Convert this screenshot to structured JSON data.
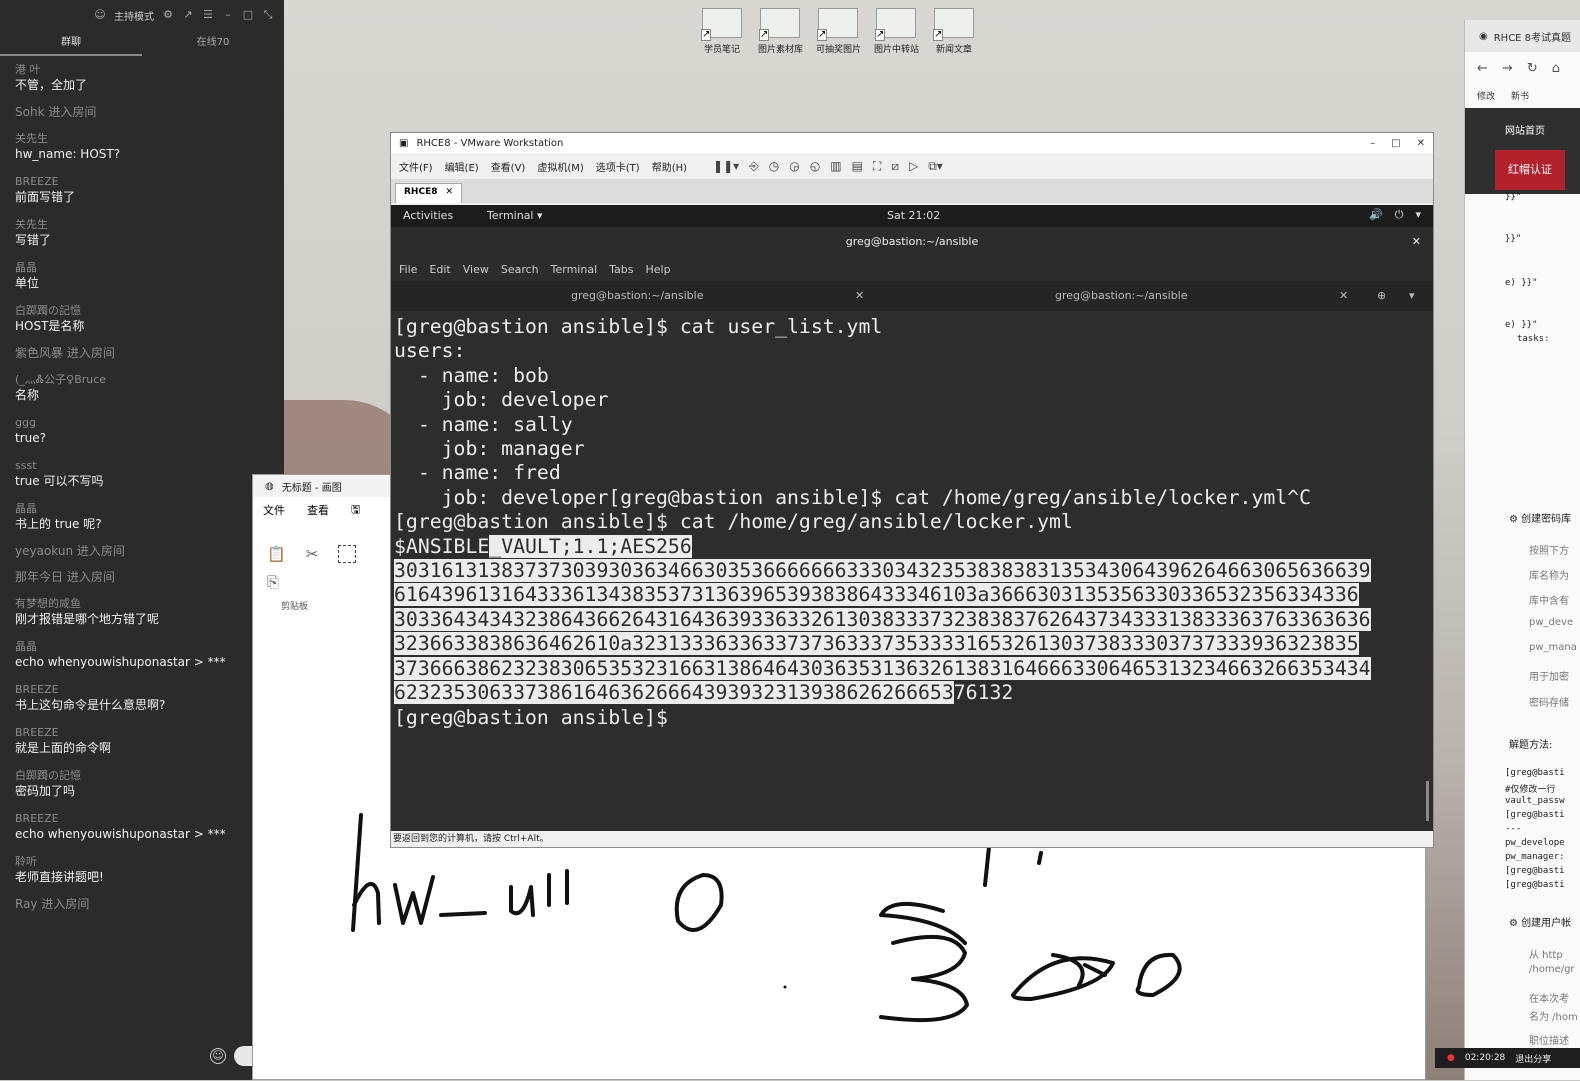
{
  "chat": {
    "top_label": "主持模式",
    "tabs": [
      "群聊",
      "在线70"
    ],
    "messages": [
      {
        "who": "港 叶",
        "text": "不管，全加了"
      },
      {
        "who": "Sohk 进入房间",
        "text": ""
      },
      {
        "who": "关先生",
        "text": "hw_name: HOST?"
      },
      {
        "who": "BREEZE",
        "text": "前面写错了"
      },
      {
        "who": "关先生",
        "text": "写错了"
      },
      {
        "who": "晶晶",
        "text": "单位"
      },
      {
        "who": "白踯躅の記憶",
        "text": "HOST是名称"
      },
      {
        "who": "紫色风暴 进入房间",
        "text": ""
      },
      {
        "who": "(_灬Ꮬ公子♀Bruce",
        "text": "名称"
      },
      {
        "who": "ggg",
        "text": "true?"
      },
      {
        "who": "ssst",
        "text": "true 可以不写吗"
      },
      {
        "who": "晶晶",
        "text": "书上的 true 呢?"
      },
      {
        "who": "yeyaokun 进入房间",
        "text": ""
      },
      {
        "who": "那年今日 进入房间",
        "text": ""
      },
      {
        "who": "有梦想的咸鱼",
        "text": "刚才报错是哪个地方错了呢"
      },
      {
        "who": "晶晶",
        "text": "echo whenyouwishuponastar > ***"
      },
      {
        "who": "BREEZE",
        "text": "书上这句命令是什么意思啊?"
      },
      {
        "who": "BREEZE",
        "text": "就是上面的命令啊"
      },
      {
        "who": "白踯躅の記憶",
        "text": "密码加了吗"
      },
      {
        "who": "BREEZE",
        "text": "echo whenyouwishuponastar > ***"
      },
      {
        "who": "聆听",
        "text": "老师直接讲题吧!"
      },
      {
        "who": "Ray 进入房间",
        "text": ""
      }
    ]
  },
  "desktop_icons": [
    "学员笔记",
    "图片素材库",
    "可抽奖图片",
    "图片中转站",
    "新闻文章"
  ],
  "paint": {
    "title": "无标题 - 画图",
    "menu": [
      "文件",
      "查看"
    ],
    "clipboard_label": "剪贴板",
    "handwriting": [
      "hw_u",
      "0",
      "5'",
      "300"
    ]
  },
  "browser": {
    "tab_title": "RHCE 8考试真题",
    "bookmarks": [
      "修改",
      "新书"
    ],
    "home": "网站首页",
    "redhat": "红帽认证",
    "code_lines": [
      "}}\"",
      "}}\"",
      "e) }}\"",
      "e) }}\"",
      "tasks:"
    ],
    "section1": "创建密码库",
    "items1": [
      "按照下方",
      "库名称为",
      "库中含有",
      "pw_deve",
      "pw_mana",
      "用于加密",
      "密码存储"
    ],
    "solve": "解题方法:",
    "code2": [
      "[greg@basti",
      "#仅修改一行",
      "vault_passw",
      "[greg@basti",
      "---",
      "pw_develope",
      "pw_manager:",
      "[greg@basti",
      "[greg@basti"
    ],
    "section2": "创建用户帐",
    "items2": [
      "从 http",
      "/home/gr",
      "在本次考",
      "名为 /hom",
      "职位描述"
    ],
    "timer": "02:20:28",
    "share": "退出分享"
  },
  "vmware": {
    "title": "RHCE8 - VMware Workstation",
    "menu": [
      "文件(F)",
      "编辑(E)",
      "查看(V)",
      "虚拟机(M)",
      "选项卡(T)",
      "帮助(H)"
    ],
    "tab": "RHCE8",
    "status": "要返回到您的计算机，请按 Ctrl+Alt。"
  },
  "gnome": {
    "activities": "Activities",
    "app": "Terminal ▾",
    "clock": "Sat 21:02"
  },
  "terminal": {
    "window_title": "greg@bastion:~/ansible",
    "menu": [
      "File",
      "Edit",
      "View",
      "Search",
      "Terminal",
      "Tabs",
      "Help"
    ],
    "tabs": [
      "greg@bastion:~/ansible",
      "greg@bastion:~/ansible"
    ],
    "lines": [
      "[greg@bastion ansible]$ cat user_list.yml",
      "users:",
      "  - name: bob",
      "    job: developer",
      "  - name: sally",
      "    job: manager",
      "  - name: fred",
      "    job: developer[greg@bastion ansible]$ cat /home/greg/ansible/locker.yml^C",
      "[greg@bastion ansible]$ cat /home/greg/ansible/locker.yml"
    ],
    "vault_header_a": "$ANSIBLE",
    "vault_header_b": "_VAULT;1.1;AES256",
    "vault_lines": [
      "3031613138373730393036346630353666666633303432353838383135343064396264663065636639",
      "6164396131643336134383537313639653938386433346103a3666303135356330336532356334336",
      "3033643434323864366264316436393363326130383337323838376264373433313833363763363636",
      "3236633838636462610a3231333633633737363337353333165326130373833303737333936323835",
      "3736663862323830653532316631386464303635313632613831646663306465313234663266353434",
      "6232353063373861646362666439393231393862626665376132"
    ],
    "vault_last_sel": "62323530633738616463626664393932313938626266653",
    "vault_last_rest": "76132",
    "prompt": "[greg@bastion ansible]$ "
  }
}
